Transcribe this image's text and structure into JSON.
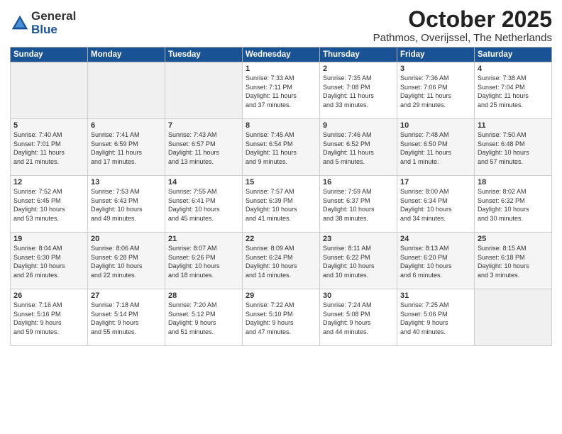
{
  "logo": {
    "general": "General",
    "blue": "Blue"
  },
  "header": {
    "month": "October 2025",
    "location": "Pathmos, Overijssel, The Netherlands"
  },
  "weekdays": [
    "Sunday",
    "Monday",
    "Tuesday",
    "Wednesday",
    "Thursday",
    "Friday",
    "Saturday"
  ],
  "weeks": [
    [
      {
        "day": "",
        "info": ""
      },
      {
        "day": "",
        "info": ""
      },
      {
        "day": "",
        "info": ""
      },
      {
        "day": "1",
        "info": "Sunrise: 7:33 AM\nSunset: 7:11 PM\nDaylight: 11 hours\nand 37 minutes."
      },
      {
        "day": "2",
        "info": "Sunrise: 7:35 AM\nSunset: 7:08 PM\nDaylight: 11 hours\nand 33 minutes."
      },
      {
        "day": "3",
        "info": "Sunrise: 7:36 AM\nSunset: 7:06 PM\nDaylight: 11 hours\nand 29 minutes."
      },
      {
        "day": "4",
        "info": "Sunrise: 7:38 AM\nSunset: 7:04 PM\nDaylight: 11 hours\nand 25 minutes."
      }
    ],
    [
      {
        "day": "5",
        "info": "Sunrise: 7:40 AM\nSunset: 7:01 PM\nDaylight: 11 hours\nand 21 minutes."
      },
      {
        "day": "6",
        "info": "Sunrise: 7:41 AM\nSunset: 6:59 PM\nDaylight: 11 hours\nand 17 minutes."
      },
      {
        "day": "7",
        "info": "Sunrise: 7:43 AM\nSunset: 6:57 PM\nDaylight: 11 hours\nand 13 minutes."
      },
      {
        "day": "8",
        "info": "Sunrise: 7:45 AM\nSunset: 6:54 PM\nDaylight: 11 hours\nand 9 minutes."
      },
      {
        "day": "9",
        "info": "Sunrise: 7:46 AM\nSunset: 6:52 PM\nDaylight: 11 hours\nand 5 minutes."
      },
      {
        "day": "10",
        "info": "Sunrise: 7:48 AM\nSunset: 6:50 PM\nDaylight: 11 hours\nand 1 minute."
      },
      {
        "day": "11",
        "info": "Sunrise: 7:50 AM\nSunset: 6:48 PM\nDaylight: 10 hours\nand 57 minutes."
      }
    ],
    [
      {
        "day": "12",
        "info": "Sunrise: 7:52 AM\nSunset: 6:45 PM\nDaylight: 10 hours\nand 53 minutes."
      },
      {
        "day": "13",
        "info": "Sunrise: 7:53 AM\nSunset: 6:43 PM\nDaylight: 10 hours\nand 49 minutes."
      },
      {
        "day": "14",
        "info": "Sunrise: 7:55 AM\nSunset: 6:41 PM\nDaylight: 10 hours\nand 45 minutes."
      },
      {
        "day": "15",
        "info": "Sunrise: 7:57 AM\nSunset: 6:39 PM\nDaylight: 10 hours\nand 41 minutes."
      },
      {
        "day": "16",
        "info": "Sunrise: 7:59 AM\nSunset: 6:37 PM\nDaylight: 10 hours\nand 38 minutes."
      },
      {
        "day": "17",
        "info": "Sunrise: 8:00 AM\nSunset: 6:34 PM\nDaylight: 10 hours\nand 34 minutes."
      },
      {
        "day": "18",
        "info": "Sunrise: 8:02 AM\nSunset: 6:32 PM\nDaylight: 10 hours\nand 30 minutes."
      }
    ],
    [
      {
        "day": "19",
        "info": "Sunrise: 8:04 AM\nSunset: 6:30 PM\nDaylight: 10 hours\nand 26 minutes."
      },
      {
        "day": "20",
        "info": "Sunrise: 8:06 AM\nSunset: 6:28 PM\nDaylight: 10 hours\nand 22 minutes."
      },
      {
        "day": "21",
        "info": "Sunrise: 8:07 AM\nSunset: 6:26 PM\nDaylight: 10 hours\nand 18 minutes."
      },
      {
        "day": "22",
        "info": "Sunrise: 8:09 AM\nSunset: 6:24 PM\nDaylight: 10 hours\nand 14 minutes."
      },
      {
        "day": "23",
        "info": "Sunrise: 8:11 AM\nSunset: 6:22 PM\nDaylight: 10 hours\nand 10 minutes."
      },
      {
        "day": "24",
        "info": "Sunrise: 8:13 AM\nSunset: 6:20 PM\nDaylight: 10 hours\nand 6 minutes."
      },
      {
        "day": "25",
        "info": "Sunrise: 8:15 AM\nSunset: 6:18 PM\nDaylight: 10 hours\nand 3 minutes."
      }
    ],
    [
      {
        "day": "26",
        "info": "Sunrise: 7:16 AM\nSunset: 5:16 PM\nDaylight: 9 hours\nand 59 minutes."
      },
      {
        "day": "27",
        "info": "Sunrise: 7:18 AM\nSunset: 5:14 PM\nDaylight: 9 hours\nand 55 minutes."
      },
      {
        "day": "28",
        "info": "Sunrise: 7:20 AM\nSunset: 5:12 PM\nDaylight: 9 hours\nand 51 minutes."
      },
      {
        "day": "29",
        "info": "Sunrise: 7:22 AM\nSunset: 5:10 PM\nDaylight: 9 hours\nand 47 minutes."
      },
      {
        "day": "30",
        "info": "Sunrise: 7:24 AM\nSunset: 5:08 PM\nDaylight: 9 hours\nand 44 minutes."
      },
      {
        "day": "31",
        "info": "Sunrise: 7:25 AM\nSunset: 5:06 PM\nDaylight: 9 hours\nand 40 minutes."
      },
      {
        "day": "",
        "info": ""
      }
    ]
  ]
}
